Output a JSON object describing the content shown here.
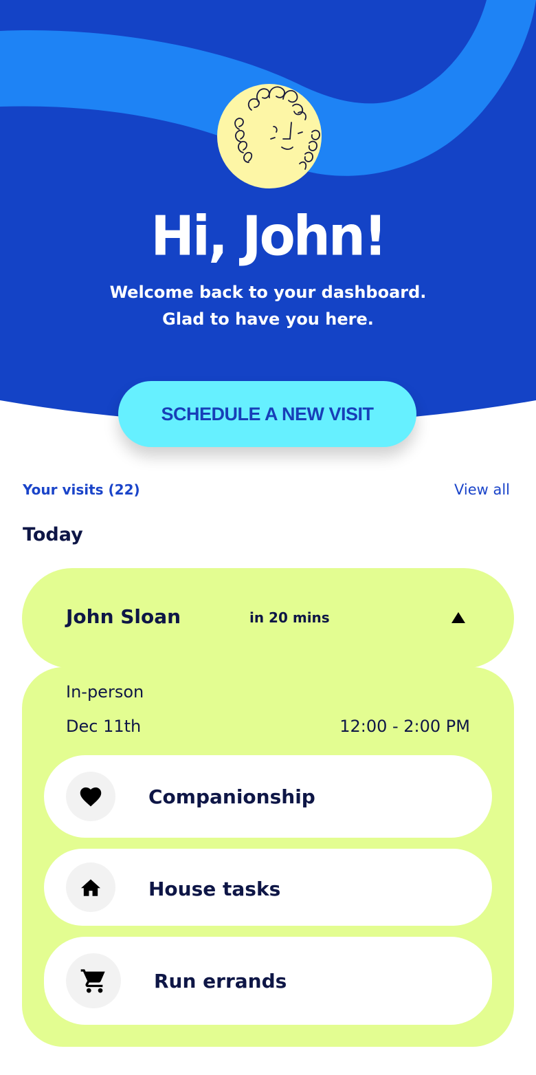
{
  "hero": {
    "greeting": "Hi, John!",
    "welcome_line1": "Welcome back to your dashboard.",
    "welcome_line2": "Glad to have you here.",
    "avatar_icon": "curly-hair-face-avatar"
  },
  "cta": {
    "label": "SCHEDULE A NEW VISIT"
  },
  "visits": {
    "count_label": "Your visits (22)",
    "view_all_label": "View all",
    "section_label": "Today"
  },
  "visit": {
    "caregiver": "John Sloan",
    "eta": "in 20 mins",
    "toggle_icon": "triangle-up-icon",
    "type": "In-person",
    "date": "Dec 11th",
    "time": "12:00 - 2:00 PM",
    "services": [
      {
        "label": "Companionship",
        "icon": "heart-icon"
      },
      {
        "label": "House tasks",
        "icon": "house-icon"
      },
      {
        "label": "Run errands",
        "icon": "cart-icon"
      }
    ]
  },
  "colors": {
    "hero_bg": "#1443c6",
    "hero_wave": "#1e83f5",
    "cta_bg": "#66f0ff",
    "cta_text": "#173fb8",
    "card_bg": "#e3fd91",
    "accent_text": "#1a44c9",
    "dark_text": "#0e1646",
    "avatar_face": "#fdf6a6"
  }
}
